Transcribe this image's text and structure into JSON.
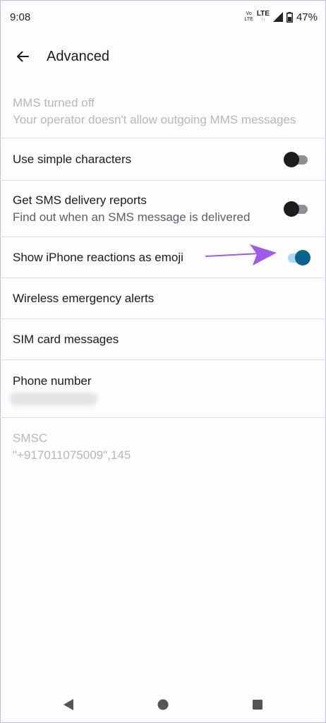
{
  "status_bar": {
    "time": "9:08",
    "volte_top": "Vo",
    "volte_bottom": "LTE",
    "network": "LTE",
    "network_arrows": "↑↓",
    "battery": "47%"
  },
  "app_bar": {
    "title": "Advanced"
  },
  "settings": {
    "mms": {
      "title": "MMS turned off",
      "subtitle": "Your operator doesn't allow outgoing MMS messages"
    },
    "simple_characters": {
      "title": "Use simple characters",
      "enabled": false
    },
    "sms_delivery": {
      "title": "Get SMS delivery reports",
      "subtitle": "Find out when an SMS message is delivered",
      "enabled": false
    },
    "iphone_reactions": {
      "title": "Show iPhone reactions as emoji",
      "enabled": true
    },
    "wireless_alerts": {
      "title": "Wireless emergency alerts"
    },
    "sim_messages": {
      "title": "SIM card messages"
    },
    "phone_number": {
      "title": "Phone number"
    },
    "smsc": {
      "title": "SMSC",
      "value": "\"+917011075009\",145"
    }
  },
  "colors": {
    "accent": "#0a6389",
    "accent_track": "#a9d8f0",
    "annotation_arrow": "#a05ae8"
  },
  "icons": {
    "back": "arrow-back-icon",
    "nav_back": "triangle-back-icon",
    "nav_home": "circle-home-icon",
    "nav_recents": "square-recents-icon"
  }
}
